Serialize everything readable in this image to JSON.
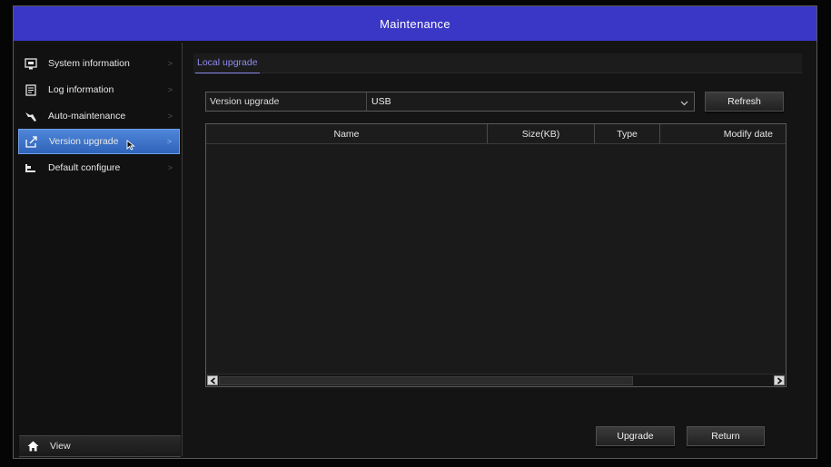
{
  "window": {
    "title": "Maintenance"
  },
  "sidebar": {
    "items": [
      {
        "label": "System information",
        "icon": "system-info-icon"
      },
      {
        "label": "Log information",
        "icon": "log-icon"
      },
      {
        "label": "Auto-maintenance",
        "icon": "wrench-icon"
      },
      {
        "label": "Version upgrade",
        "icon": "upgrade-icon",
        "active": true
      },
      {
        "label": "Default configure",
        "icon": "default-config-icon"
      }
    ],
    "view_label": "View"
  },
  "tabs": [
    {
      "label": "Local upgrade",
      "active": true
    }
  ],
  "version_upgrade": {
    "label": "Version upgrade",
    "selected": "USB"
  },
  "buttons": {
    "refresh": "Refresh",
    "upgrade": "Upgrade",
    "return": "Return"
  },
  "table": {
    "columns": [
      "Name",
      "Size(KB)",
      "Type",
      "Modify date"
    ],
    "rows": []
  },
  "colors": {
    "titlebar": "#3a37c6",
    "active_item": "#3f74cc",
    "tab_accent": "#8f8cf0"
  }
}
